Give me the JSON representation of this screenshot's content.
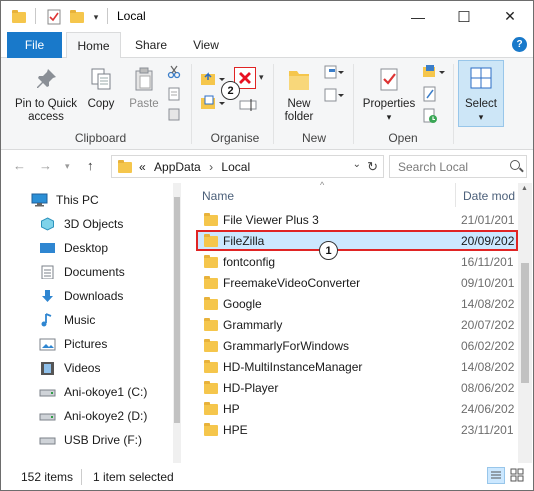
{
  "window": {
    "title": "Local",
    "controls": {
      "minimize": "—",
      "maximize": "☐",
      "close": "✕"
    }
  },
  "ribbon_tabs": [
    {
      "label": "File"
    },
    {
      "label": "Home"
    },
    {
      "label": "Share"
    },
    {
      "label": "View"
    }
  ],
  "ribbon": {
    "clipboard": {
      "pin_label_1": "Pin to Quick",
      "pin_label_2": "access",
      "copy": "Copy",
      "paste": "Paste",
      "group": "Clipboard"
    },
    "organise": {
      "group": "Organise",
      "callout": "2"
    },
    "new": {
      "folder_label_1": "New",
      "folder_label_2": "folder",
      "group": "New"
    },
    "open": {
      "properties": "Properties",
      "group": "Open"
    },
    "select": {
      "label": "Select"
    },
    "help": "?"
  },
  "address": {
    "overflow": "«",
    "crumbs": [
      "AppData",
      "Local"
    ],
    "separator": "›",
    "search_placeholder": "Search Local"
  },
  "nav_pane": {
    "items": [
      {
        "label": "This PC",
        "icon": "pc-icon"
      },
      {
        "label": "3D Objects",
        "icon": "3d-objects-icon"
      },
      {
        "label": "Desktop",
        "icon": "desktop-icon"
      },
      {
        "label": "Documents",
        "icon": "documents-icon"
      },
      {
        "label": "Downloads",
        "icon": "downloads-icon"
      },
      {
        "label": "Music",
        "icon": "music-icon"
      },
      {
        "label": "Pictures",
        "icon": "pictures-icon"
      },
      {
        "label": "Videos",
        "icon": "videos-icon"
      },
      {
        "label": "Ani-okoye1 (C:)",
        "icon": "drive-icon"
      },
      {
        "label": "Ani-okoye2 (D:)",
        "icon": "drive-icon"
      },
      {
        "label": "USB Drive (F:)",
        "icon": "usb-drive-icon"
      }
    ]
  },
  "file_list": {
    "columns": {
      "name": "Name",
      "date": "Date mod"
    },
    "rows": [
      {
        "name": "File Viewer Plus 3",
        "date": "21/01/201"
      },
      {
        "name": "FileZilla",
        "date": "20/09/202",
        "selected": true
      },
      {
        "name": "fontconfig",
        "date": "16/11/201"
      },
      {
        "name": "FreemakeVideoConverter",
        "date": "09/10/201"
      },
      {
        "name": "Google",
        "date": "14/08/202"
      },
      {
        "name": "Grammarly",
        "date": "20/07/202"
      },
      {
        "name": "GrammarlyForWindows",
        "date": "06/02/202"
      },
      {
        "name": "HD-MultiInstanceManager",
        "date": "14/08/202"
      },
      {
        "name": "HD-Player",
        "date": "08/06/202"
      },
      {
        "name": "HP",
        "date": "24/06/202"
      },
      {
        "name": "HPE",
        "date": "23/11/201"
      }
    ],
    "callout": "1"
  },
  "status_bar": {
    "count": "152 items",
    "selection": "1 item selected"
  },
  "colors": {
    "accent": "#1979ca",
    "selection": "#cce8ff",
    "highlight_border": "#e02424",
    "folder": "#f5c64c",
    "delete_red": "#e81123"
  }
}
